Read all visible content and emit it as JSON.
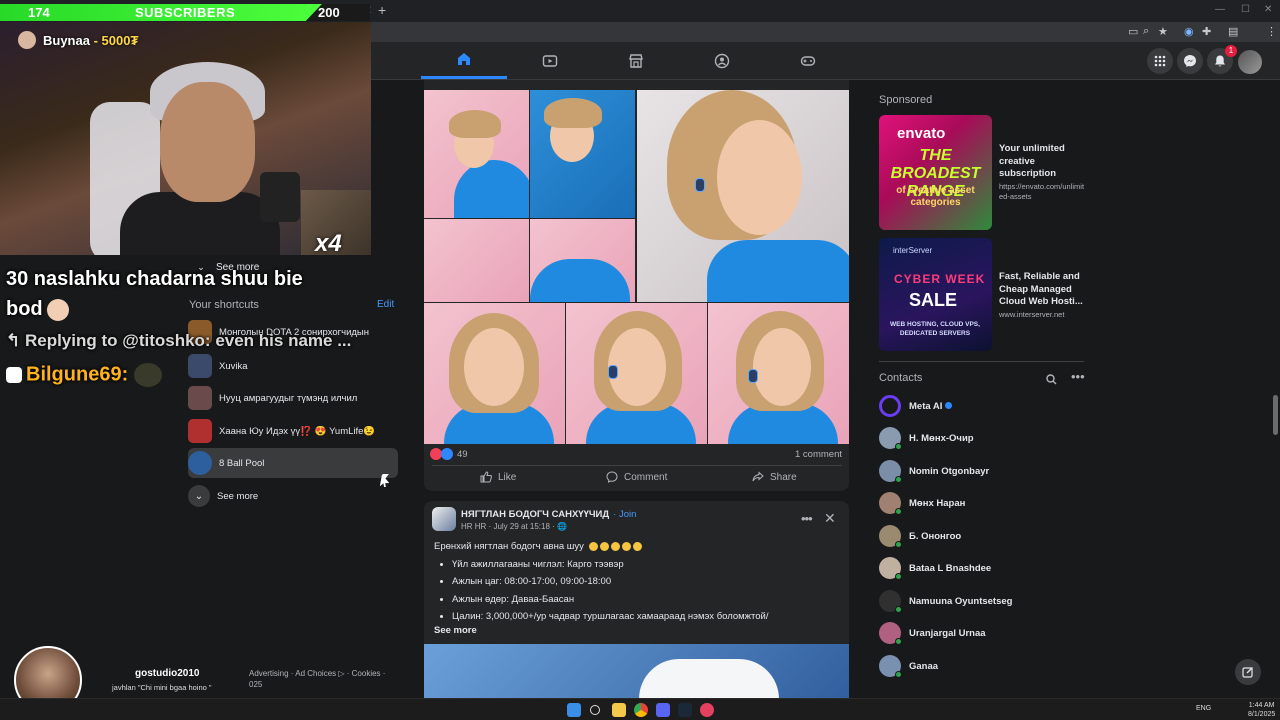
{
  "colors": {
    "fb_bg": "#18191a",
    "card": "#242526",
    "accent": "#2d88ff",
    "sub_green": "#28d928",
    "donor_gold": "#ffd84a",
    "chat_name": "#ffb21e"
  },
  "stream": {
    "sub_bar": {
      "current": "174",
      "label": "SUBSCRIBERS",
      "goal": "200",
      "progress": 0.87
    },
    "donation": {
      "name": "Buynaa",
      "amount": "- 5000₮"
    },
    "cat_multiplier": "x4",
    "chat": {
      "line1": "30 naslahku chadarna shuu bie",
      "line2": "bod",
      "line3": "Replying to @titoshko: even his name ...",
      "line4_name": "Bilgune69:"
    },
    "donor2": {
      "name": "gostudio2010",
      "message": "javhlan \"Chi mini bgaa hoino \""
    }
  },
  "nav": {
    "tabs": [
      {
        "name": "home-icon"
      },
      {
        "name": "video-icon"
      },
      {
        "name": "marketplace-icon"
      },
      {
        "name": "groups-icon"
      },
      {
        "name": "gaming-icon"
      }
    ],
    "notif_count": "1"
  },
  "left": {
    "see_more_top": "See more",
    "shortcuts_title": "Your shortcuts",
    "edit": "Edit",
    "shortcuts": [
      {
        "label": "Монголын DOTA 2 сонирхогчидын",
        "color": "#8a5a2a"
      },
      {
        "label": "Xuvika",
        "color": "#3b4a6b"
      },
      {
        "label": "Нууц амрагуудыг түмэнд илчил",
        "color": "#6a4a4a"
      },
      {
        "label": "Хаана Юу Идэх үү⁉️ 😍 YumLife😉",
        "color": "#b03030"
      },
      {
        "label": "8 Ball Pool",
        "color": "#2d5f9e"
      }
    ],
    "see_more_bottom": "See more",
    "footer": "Advertising · Ad Choices ▷ · Cookies · 025"
  },
  "post1": {
    "reactions_count": "49",
    "comments": "1 comment",
    "actions": {
      "like": "Like",
      "comment": "Comment",
      "share": "Share"
    }
  },
  "post2": {
    "group": "НЯГТЛАН БОДОГЧ САНХҮҮЧИД",
    "join": "· Join",
    "meta": "HR HR · July 29 at 15:18 · 🌐",
    "intro": "Ерөнхий нягтлан бодогч авна шуу",
    "bullets": [
      "Үйл ажиллагааны чиглэл: Карго тээвэр",
      "Ажлын цаг: 08:00-17:00, 09:00-18:00",
      "Ажлын өдөр: Даваа-Баасан",
      "Цалин: 3,000,000+/ур чадвар туршлагаас хамаараад нэмэх боломжтой/"
    ],
    "see_more": "See more"
  },
  "right": {
    "sponsored": "Sponsored",
    "ads": [
      {
        "title": "Your unlimited creative subscription",
        "url": "https://envato.com/unlimited-assets",
        "img_logo": "envato",
        "img_headline": "THE BROADEST RANGE",
        "img_sub": "of creative asset categories"
      },
      {
        "title": "Fast, Reliable and Cheap Managed Cloud Web Hosti...",
        "url": "www.interserver.net",
        "img_brand": "interServer",
        "img_headline1": "CYBER WEEK",
        "img_headline2": "SALE",
        "img_tag": "WEB HOSTING, CLOUD VPS, DEDICATED SERVERS"
      }
    ],
    "contacts_title": "Contacts",
    "contacts": [
      {
        "name": "Meta AI",
        "color": "#6a3df0",
        "verified": true,
        "online": false
      },
      {
        "name": "Н. Мөнх-Очир",
        "color": "#8a9bb0",
        "online": true
      },
      {
        "name": "Nomin Otgonbayr",
        "color": "#7a8ea8",
        "online": true
      },
      {
        "name": "Мөнх Наран",
        "color": "#a08070",
        "online": true
      },
      {
        "name": "Б. Ононгоо",
        "color": "#9a8a70",
        "online": true
      },
      {
        "name": "Bataa L Bnashdee",
        "color": "#c0b0a0",
        "online": true
      },
      {
        "name": "Namuuna Oyuntsetseg",
        "color": "#303030",
        "online": true
      },
      {
        "name": "Uranjargal Urnaa",
        "color": "#b06080",
        "online": true
      },
      {
        "name": "Ganaa",
        "color": "#7a90b0",
        "online": true
      }
    ]
  },
  "taskbar": {
    "lang": "ENG",
    "time": "1:44 AM",
    "date": "8/1/2025"
  }
}
